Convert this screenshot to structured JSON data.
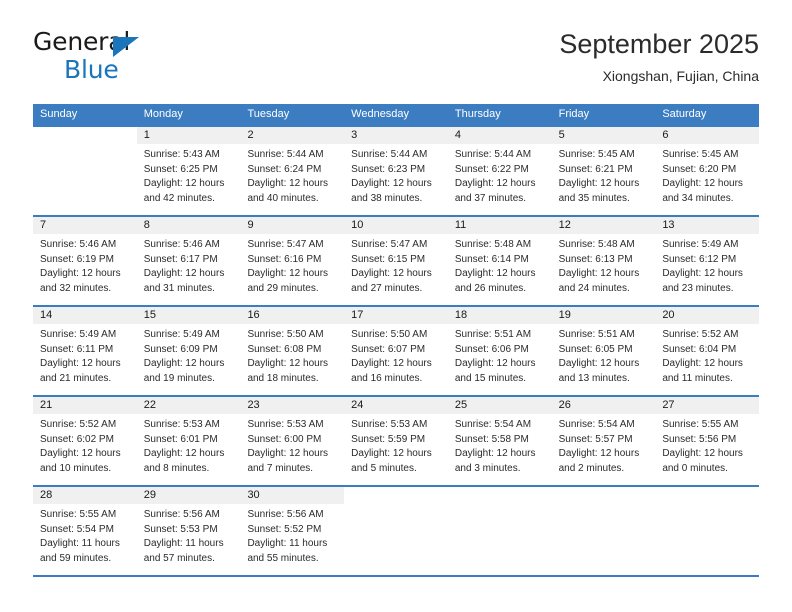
{
  "brand": {
    "name_top": "General",
    "name_bottom": "Blue",
    "triangle_icon": "triangle-icon",
    "accent_color": "#1b75bb"
  },
  "header": {
    "title": "September 2025",
    "subtitle": "Xiongshan, Fujian, China"
  },
  "theme": {
    "header_blue": "#3b7dc0",
    "day_band_gray": "#f0f0f0"
  },
  "calendar": {
    "weekday_headers": [
      "Sunday",
      "Monday",
      "Tuesday",
      "Wednesday",
      "Thursday",
      "Friday",
      "Saturday"
    ],
    "weeks": [
      [
        {
          "day": "",
          "lines": []
        },
        {
          "day": "1",
          "lines": [
            "Sunrise: 5:43 AM",
            "Sunset: 6:25 PM",
            "Daylight: 12 hours",
            "and 42 minutes."
          ]
        },
        {
          "day": "2",
          "lines": [
            "Sunrise: 5:44 AM",
            "Sunset: 6:24 PM",
            "Daylight: 12 hours",
            "and 40 minutes."
          ]
        },
        {
          "day": "3",
          "lines": [
            "Sunrise: 5:44 AM",
            "Sunset: 6:23 PM",
            "Daylight: 12 hours",
            "and 38 minutes."
          ]
        },
        {
          "day": "4",
          "lines": [
            "Sunrise: 5:44 AM",
            "Sunset: 6:22 PM",
            "Daylight: 12 hours",
            "and 37 minutes."
          ]
        },
        {
          "day": "5",
          "lines": [
            "Sunrise: 5:45 AM",
            "Sunset: 6:21 PM",
            "Daylight: 12 hours",
            "and 35 minutes."
          ]
        },
        {
          "day": "6",
          "lines": [
            "Sunrise: 5:45 AM",
            "Sunset: 6:20 PM",
            "Daylight: 12 hours",
            "and 34 minutes."
          ]
        }
      ],
      [
        {
          "day": "7",
          "lines": [
            "Sunrise: 5:46 AM",
            "Sunset: 6:19 PM",
            "Daylight: 12 hours",
            "and 32 minutes."
          ]
        },
        {
          "day": "8",
          "lines": [
            "Sunrise: 5:46 AM",
            "Sunset: 6:17 PM",
            "Daylight: 12 hours",
            "and 31 minutes."
          ]
        },
        {
          "day": "9",
          "lines": [
            "Sunrise: 5:47 AM",
            "Sunset: 6:16 PM",
            "Daylight: 12 hours",
            "and 29 minutes."
          ]
        },
        {
          "day": "10",
          "lines": [
            "Sunrise: 5:47 AM",
            "Sunset: 6:15 PM",
            "Daylight: 12 hours",
            "and 27 minutes."
          ]
        },
        {
          "day": "11",
          "lines": [
            "Sunrise: 5:48 AM",
            "Sunset: 6:14 PM",
            "Daylight: 12 hours",
            "and 26 minutes."
          ]
        },
        {
          "day": "12",
          "lines": [
            "Sunrise: 5:48 AM",
            "Sunset: 6:13 PM",
            "Daylight: 12 hours",
            "and 24 minutes."
          ]
        },
        {
          "day": "13",
          "lines": [
            "Sunrise: 5:49 AM",
            "Sunset: 6:12 PM",
            "Daylight: 12 hours",
            "and 23 minutes."
          ]
        }
      ],
      [
        {
          "day": "14",
          "lines": [
            "Sunrise: 5:49 AM",
            "Sunset: 6:11 PM",
            "Daylight: 12 hours",
            "and 21 minutes."
          ]
        },
        {
          "day": "15",
          "lines": [
            "Sunrise: 5:49 AM",
            "Sunset: 6:09 PM",
            "Daylight: 12 hours",
            "and 19 minutes."
          ]
        },
        {
          "day": "16",
          "lines": [
            "Sunrise: 5:50 AM",
            "Sunset: 6:08 PM",
            "Daylight: 12 hours",
            "and 18 minutes."
          ]
        },
        {
          "day": "17",
          "lines": [
            "Sunrise: 5:50 AM",
            "Sunset: 6:07 PM",
            "Daylight: 12 hours",
            "and 16 minutes."
          ]
        },
        {
          "day": "18",
          "lines": [
            "Sunrise: 5:51 AM",
            "Sunset: 6:06 PM",
            "Daylight: 12 hours",
            "and 15 minutes."
          ]
        },
        {
          "day": "19",
          "lines": [
            "Sunrise: 5:51 AM",
            "Sunset: 6:05 PM",
            "Daylight: 12 hours",
            "and 13 minutes."
          ]
        },
        {
          "day": "20",
          "lines": [
            "Sunrise: 5:52 AM",
            "Sunset: 6:04 PM",
            "Daylight: 12 hours",
            "and 11 minutes."
          ]
        }
      ],
      [
        {
          "day": "21",
          "lines": [
            "Sunrise: 5:52 AM",
            "Sunset: 6:02 PM",
            "Daylight: 12 hours",
            "and 10 minutes."
          ]
        },
        {
          "day": "22",
          "lines": [
            "Sunrise: 5:53 AM",
            "Sunset: 6:01 PM",
            "Daylight: 12 hours",
            "and 8 minutes."
          ]
        },
        {
          "day": "23",
          "lines": [
            "Sunrise: 5:53 AM",
            "Sunset: 6:00 PM",
            "Daylight: 12 hours",
            "and 7 minutes."
          ]
        },
        {
          "day": "24",
          "lines": [
            "Sunrise: 5:53 AM",
            "Sunset: 5:59 PM",
            "Daylight: 12 hours",
            "and 5 minutes."
          ]
        },
        {
          "day": "25",
          "lines": [
            "Sunrise: 5:54 AM",
            "Sunset: 5:58 PM",
            "Daylight: 12 hours",
            "and 3 minutes."
          ]
        },
        {
          "day": "26",
          "lines": [
            "Sunrise: 5:54 AM",
            "Sunset: 5:57 PM",
            "Daylight: 12 hours",
            "and 2 minutes."
          ]
        },
        {
          "day": "27",
          "lines": [
            "Sunrise: 5:55 AM",
            "Sunset: 5:56 PM",
            "Daylight: 12 hours",
            "and 0 minutes."
          ]
        }
      ],
      [
        {
          "day": "28",
          "lines": [
            "Sunrise: 5:55 AM",
            "Sunset: 5:54 PM",
            "Daylight: 11 hours",
            "and 59 minutes."
          ]
        },
        {
          "day": "29",
          "lines": [
            "Sunrise: 5:56 AM",
            "Sunset: 5:53 PM",
            "Daylight: 11 hours",
            "and 57 minutes."
          ]
        },
        {
          "day": "30",
          "lines": [
            "Sunrise: 5:56 AM",
            "Sunset: 5:52 PM",
            "Daylight: 11 hours",
            "and 55 minutes."
          ]
        },
        {
          "day": "",
          "lines": []
        },
        {
          "day": "",
          "lines": []
        },
        {
          "day": "",
          "lines": []
        },
        {
          "day": "",
          "lines": []
        }
      ]
    ]
  }
}
